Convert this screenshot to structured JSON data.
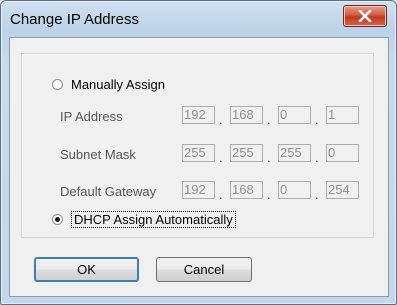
{
  "window": {
    "title": "Change IP Address"
  },
  "options": {
    "manual_label": "Manually Assign",
    "dhcp_label": "DHCP Assign Automatically",
    "selected": "dhcp"
  },
  "fields": [
    {
      "label": "IP Address",
      "octets": [
        "192",
        "168",
        "0",
        "1"
      ]
    },
    {
      "label": "Subnet Mask",
      "octets": [
        "255",
        "255",
        "255",
        "0"
      ]
    },
    {
      "label": "Default Gateway",
      "octets": [
        "192",
        "168",
        "0",
        "254"
      ]
    }
  ],
  "separator": ".",
  "buttons": {
    "ok_label": "OK",
    "cancel_label": "Cancel"
  },
  "icons": {
    "close": "close-icon"
  },
  "colors": {
    "close_button": "#c2391e",
    "disabled_text": "#8e8e8e"
  }
}
